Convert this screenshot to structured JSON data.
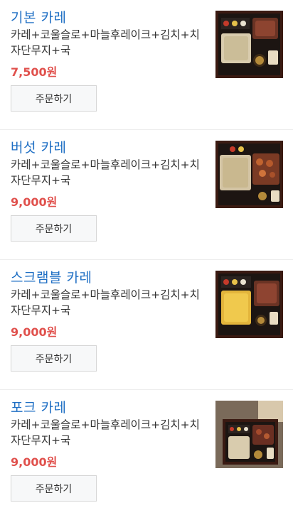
{
  "menu": [
    {
      "name": "기본 카레",
      "description": "카레+코울슬로+마늘후레이크+김치+치자단무지+국",
      "price": "7,500원",
      "order_label": "주문하기",
      "image_icon": "curry-set-photo-icon"
    },
    {
      "name": "버섯 카레",
      "description": "카레+코울슬로+마늘후레이크+김치+치자단무지+국",
      "price": "9,000원",
      "order_label": "주문하기",
      "image_icon": "mushroom-curry-set-photo-icon"
    },
    {
      "name": "스크램블 카레",
      "description": "카레+코울슬로+마늘후레이크+김치+치자단무지+국",
      "price": "9,000원",
      "order_label": "주문하기",
      "image_icon": "scramble-curry-set-photo-icon"
    },
    {
      "name": "포크 카레",
      "description": "카레+코울슬로+마늘후레이크+김치+치자단무지+국",
      "price": "9,000원",
      "order_label": "주문하기",
      "image_icon": "pork-curry-set-photo-icon"
    }
  ],
  "colors": {
    "title": "#1f6fc4",
    "price": "#e0504c",
    "button_bg": "#f7f8f9"
  }
}
